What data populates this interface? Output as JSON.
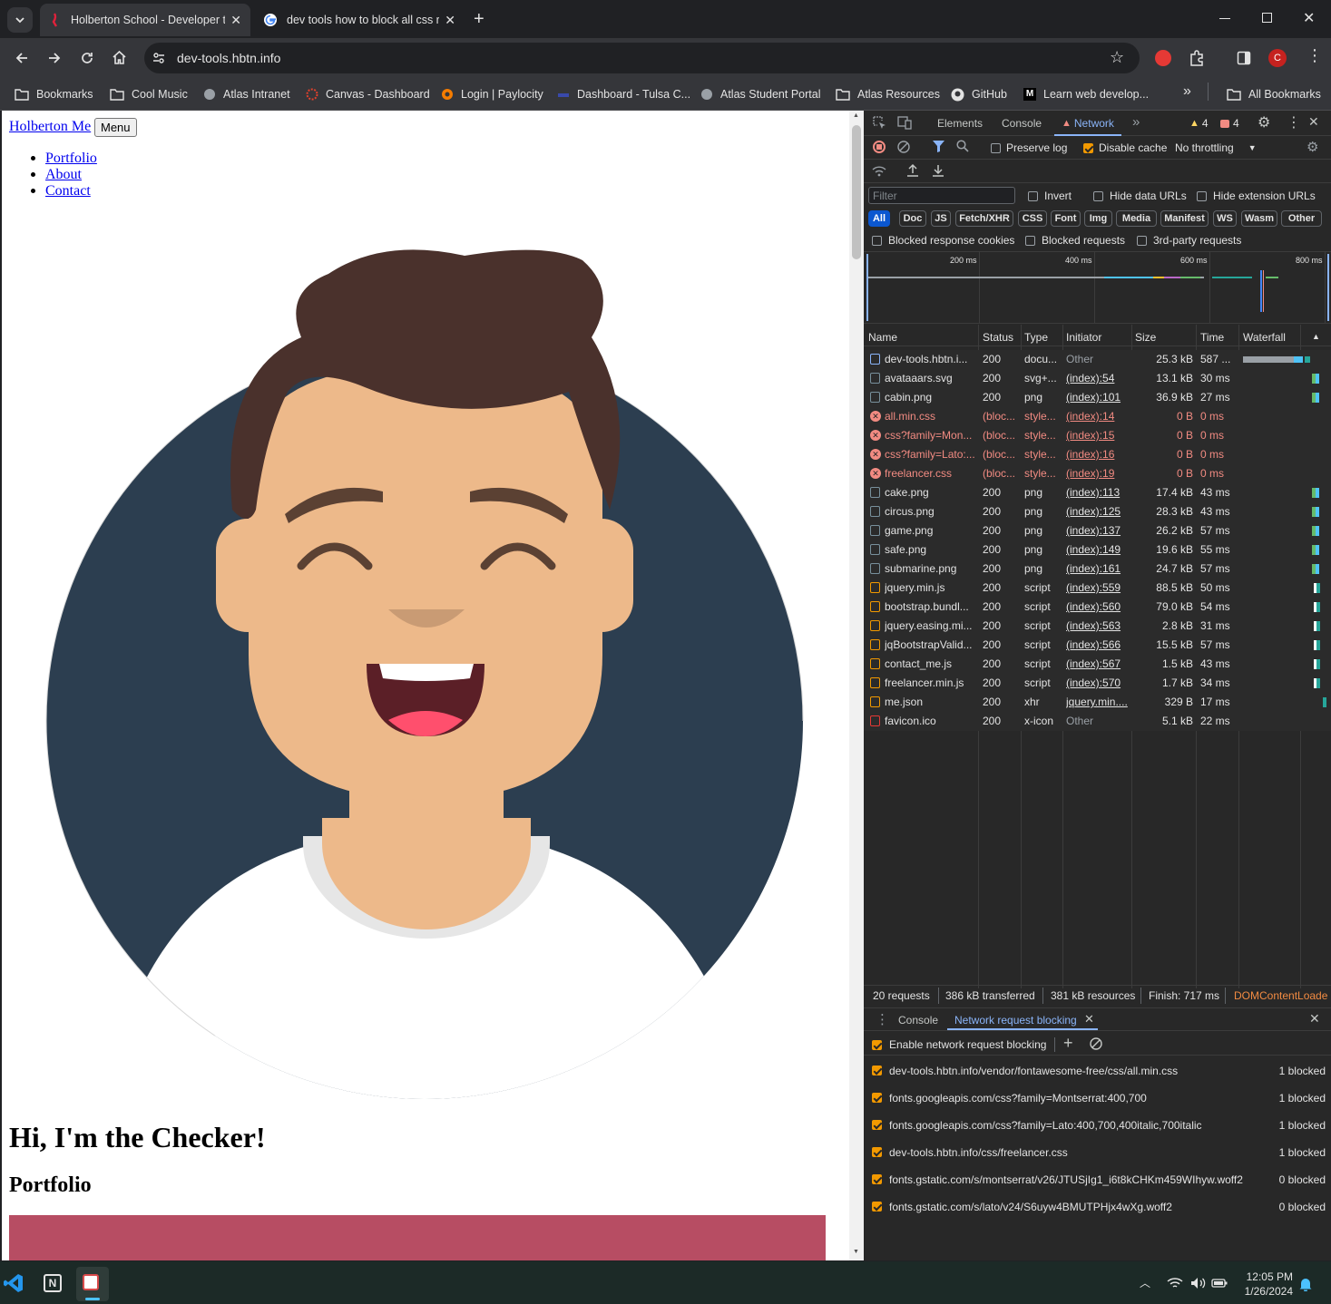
{
  "browser": {
    "tabs": [
      {
        "title": "Holberton School - Developer t",
        "active": true
      },
      {
        "title": "dev tools how to block all css re",
        "active": false
      }
    ],
    "url": "dev-tools.hbtn.info",
    "profile_initial": "C",
    "bookmarks": [
      "Bookmarks",
      "Cool Music",
      "Atlas Intranet",
      "Canvas - Dashboard",
      "Login | Paylocity",
      "Dashboard - Tulsa C...",
      "Atlas Student Portal",
      "Atlas Resources",
      "GitHub",
      "Learn web develop..."
    ],
    "all_bookmarks": "All Bookmarks"
  },
  "page": {
    "brand": "Holberton Me",
    "menu_button": "Menu",
    "nav": [
      "Portfolio",
      "About",
      "Contact"
    ],
    "heading": "Hi, I'm the Checker!",
    "subheading": "Portfolio"
  },
  "devtools": {
    "tabs": [
      "Elements",
      "Console",
      "Network"
    ],
    "warnings": "4",
    "errors": "4",
    "preserve_log": "Preserve log",
    "disable_cache": "Disable cache",
    "throttling": "No throttling",
    "filter_placeholder": "Filter",
    "invert": "Invert",
    "hide_data_urls": "Hide data URLs",
    "hide_ext_urls": "Hide extension URLs",
    "type_filters": [
      "All",
      "Doc",
      "JS",
      "Fetch/XHR",
      "CSS",
      "Font",
      "Img",
      "Media",
      "Manifest",
      "WS",
      "Wasm",
      "Other"
    ],
    "blocked_cookies": "Blocked response cookies",
    "blocked_requests": "Blocked requests",
    "third_party": "3rd-party requests",
    "timeline_ticks": [
      "200 ms",
      "400 ms",
      "600 ms",
      "800 ms"
    ],
    "columns": [
      "Name",
      "Status",
      "Type",
      "Initiator",
      "Size",
      "Time",
      "Waterfall"
    ],
    "requests": [
      {
        "name": "dev-tools.hbtn.i...",
        "status": "200",
        "type": "docu...",
        "initiator": "Other",
        "size": "25.3 kB",
        "time": "587 ...",
        "kind": "doc"
      },
      {
        "name": "avataaars.svg",
        "status": "200",
        "type": "svg+...",
        "initiator": "(index):54",
        "size": "13.1 kB",
        "time": "30 ms",
        "kind": "img"
      },
      {
        "name": "cabin.png",
        "status": "200",
        "type": "png",
        "initiator": "(index):101",
        "size": "36.9 kB",
        "time": "27 ms",
        "kind": "img"
      },
      {
        "name": "all.min.css",
        "status": "(bloc...",
        "type": "style...",
        "initiator": "(index):14",
        "size": "0 B",
        "time": "0 ms",
        "kind": "blocked"
      },
      {
        "name": "css?family=Mon...",
        "status": "(bloc...",
        "type": "style...",
        "initiator": "(index):15",
        "size": "0 B",
        "time": "0 ms",
        "kind": "blocked"
      },
      {
        "name": "css?family=Lato:...",
        "status": "(bloc...",
        "type": "style...",
        "initiator": "(index):16",
        "size": "0 B",
        "time": "0 ms",
        "kind": "blocked"
      },
      {
        "name": "freelancer.css",
        "status": "(bloc...",
        "type": "style...",
        "initiator": "(index):19",
        "size": "0 B",
        "time": "0 ms",
        "kind": "blocked"
      },
      {
        "name": "cake.png",
        "status": "200",
        "type": "png",
        "initiator": "(index):113",
        "size": "17.4 kB",
        "time": "43 ms",
        "kind": "img"
      },
      {
        "name": "circus.png",
        "status": "200",
        "type": "png",
        "initiator": "(index):125",
        "size": "28.3 kB",
        "time": "43 ms",
        "kind": "img"
      },
      {
        "name": "game.png",
        "status": "200",
        "type": "png",
        "initiator": "(index):137",
        "size": "26.2 kB",
        "time": "57 ms",
        "kind": "img"
      },
      {
        "name": "safe.png",
        "status": "200",
        "type": "png",
        "initiator": "(index):149",
        "size": "19.6 kB",
        "time": "55 ms",
        "kind": "img"
      },
      {
        "name": "submarine.png",
        "status": "200",
        "type": "png",
        "initiator": "(index):161",
        "size": "24.7 kB",
        "time": "57 ms",
        "kind": "img"
      },
      {
        "name": "jquery.min.js",
        "status": "200",
        "type": "script",
        "initiator": "(index):559",
        "size": "88.5 kB",
        "time": "50 ms",
        "kind": "script"
      },
      {
        "name": "bootstrap.bundl...",
        "status": "200",
        "type": "script",
        "initiator": "(index):560",
        "size": "79.0 kB",
        "time": "54 ms",
        "kind": "script"
      },
      {
        "name": "jquery.easing.mi...",
        "status": "200",
        "type": "script",
        "initiator": "(index):563",
        "size": "2.8 kB",
        "time": "31 ms",
        "kind": "script"
      },
      {
        "name": "jqBootstrapValid...",
        "status": "200",
        "type": "script",
        "initiator": "(index):566",
        "size": "15.5 kB",
        "time": "57 ms",
        "kind": "script"
      },
      {
        "name": "contact_me.js",
        "status": "200",
        "type": "script",
        "initiator": "(index):567",
        "size": "1.5 kB",
        "time": "43 ms",
        "kind": "script"
      },
      {
        "name": "freelancer.min.js",
        "status": "200",
        "type": "script",
        "initiator": "(index):570",
        "size": "1.7 kB",
        "time": "34 ms",
        "kind": "script"
      },
      {
        "name": "me.json",
        "status": "200",
        "type": "xhr",
        "initiator": "jquery.min....",
        "size": "329 B",
        "time": "17 ms",
        "kind": "xhr"
      },
      {
        "name": "favicon.ico",
        "status": "200",
        "type": "x-icon",
        "initiator": "Other",
        "size": "5.1 kB",
        "time": "22 ms",
        "kind": "ico"
      }
    ],
    "summary": [
      "20 requests",
      "386 kB transferred",
      "381 kB resources",
      "Finish: 717 ms",
      "DOMContentLoade"
    ],
    "drawer_tabs": [
      "Console",
      "Network request blocking"
    ],
    "enable_blocking": "Enable network request blocking",
    "blocked_patterns": [
      {
        "pattern": "dev-tools.hbtn.info/vendor/fontawesome-free/css/all.min.css",
        "count": "1 blocked"
      },
      {
        "pattern": "fonts.googleapis.com/css?family=Montserrat:400,700",
        "count": "1 blocked"
      },
      {
        "pattern": "fonts.googleapis.com/css?family=Lato:400,700,400italic,700italic",
        "count": "1 blocked"
      },
      {
        "pattern": "dev-tools.hbtn.info/css/freelancer.css",
        "count": "1 blocked"
      },
      {
        "pattern": "fonts.gstatic.com/s/montserrat/v26/JTUSjIg1_i6t8kCHKm459WIhyw.woff2",
        "count": "0 blocked"
      },
      {
        "pattern": "fonts.gstatic.com/s/lato/v24/S6uyw4BMUTPHjx4wXg.woff2",
        "count": "0 blocked"
      }
    ]
  },
  "taskbar": {
    "time": "12:05 PM",
    "date": "1/26/2024"
  },
  "colors": {
    "accent": "#8ab4f8",
    "blocked_red": "#f28b82",
    "warning": "#fdd663",
    "page_hero": "#b74d63",
    "avatar_bg": "#2c3e50",
    "skin": "#edb98a",
    "hair": "#4a312c"
  }
}
